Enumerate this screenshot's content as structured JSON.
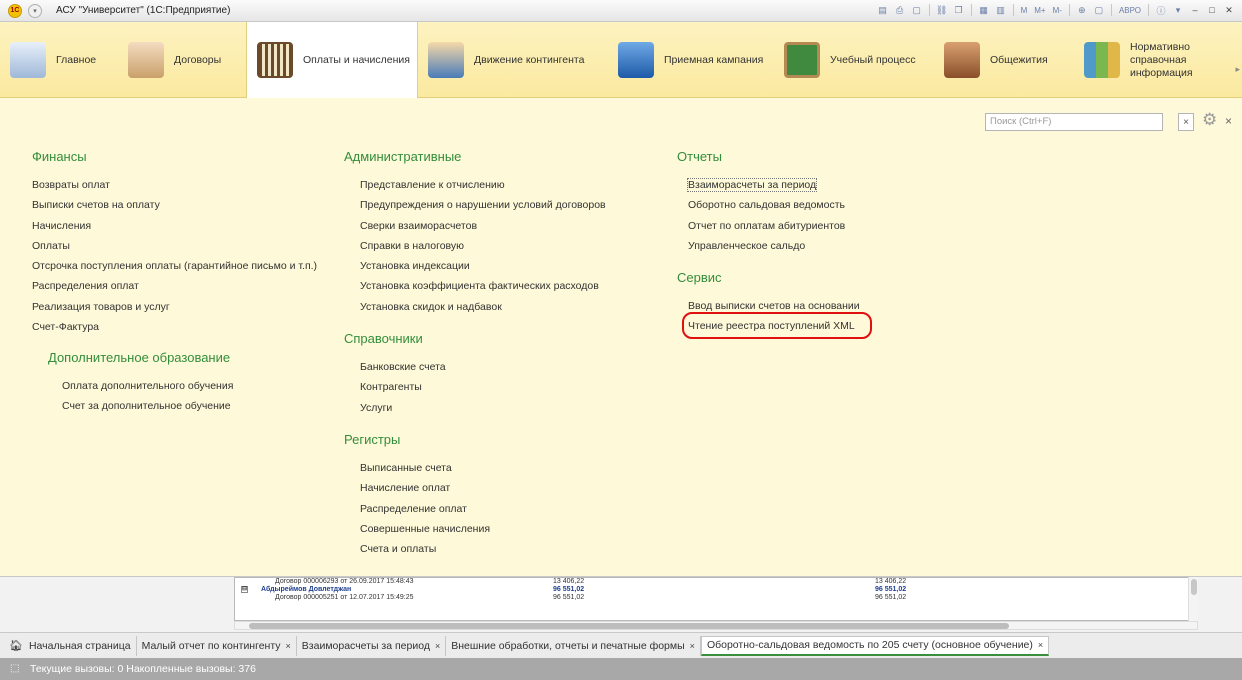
{
  "window": {
    "logo": "1С",
    "title": "АСУ \"Университет\" (1С:Предприятие)",
    "toolbar_text": [
      "M",
      "M+",
      "M-",
      "АВРО"
    ]
  },
  "sections": [
    {
      "label": "Главное",
      "icon": "desk-icon",
      "color": "#7a9cc6"
    },
    {
      "label": "Договоры",
      "icon": "handshake-icon",
      "color": "#c9a06a"
    },
    {
      "label": "Оплаты и начисления",
      "icon": "abacus-icon",
      "color": "#6b4a2a",
      "active": true
    },
    {
      "label": "Движение контингента",
      "icon": "person-desk-icon",
      "color": "#4a7bb8"
    },
    {
      "label": "Приемная кампания",
      "icon": "graduate-icon",
      "color": "#2e6fb8"
    },
    {
      "label": "Учебный процесс",
      "icon": "blackboard-icon",
      "color": "#3f8a3f"
    },
    {
      "label": "Общежития",
      "icon": "house-icon",
      "color": "#a5643a"
    },
    {
      "label": "Нормативно справочная информация",
      "icon": "books-icon",
      "color": "#4f9ac9"
    }
  ],
  "search": {
    "placeholder": "Поиск (Ctrl+F)",
    "clear": "×"
  },
  "close_label": "×",
  "groups": {
    "finance": {
      "title": "Финансы",
      "items": [
        "Возвраты оплат",
        "Выписки счетов на оплату",
        "Начисления",
        "Оплаты",
        "Отсрочка поступления оплаты (гарантийное письмо и т.п.)",
        "Распределения оплат",
        "Реализация товаров и услуг",
        "Счет-Фактура"
      ]
    },
    "extra_edu": {
      "title": "Дополнительное образование",
      "items": [
        "Оплата дополнительного обучения",
        "Счет за дополнительное обучение"
      ]
    },
    "admin": {
      "title": "Административные",
      "items": [
        "Представление к отчислению",
        "Предупреждения о нарушении условий договоров",
        "Сверки взаиморасчетов",
        "Справки в налоговую",
        "Установка индексации",
        "Установка коэффициента фактических расходов",
        "Установка скидок и надбавок"
      ]
    },
    "catalogs": {
      "title": "Справочники",
      "items": [
        "Банковские счета",
        "Контрагенты",
        "Услуги"
      ]
    },
    "registers": {
      "title": "Регистры",
      "items": [
        "Выписанные счета",
        "Начисление оплат",
        "Распределение оплат",
        "Совершенные начисления",
        "Счета и оплаты"
      ]
    },
    "reports": {
      "title": "Отчеты",
      "items": [
        "Взаиморасчеты за период",
        "Оборотно сальдовая ведомость",
        "Отчет по оплатам абитуриентов",
        "Управленческое сальдо"
      ]
    },
    "service": {
      "title": "Сервис",
      "items": [
        "Ввод выписки счетов на основании",
        "Чтение реестра поступлений XML"
      ]
    }
  },
  "background_table": {
    "rows": [
      {
        "label": "Договор 000006293 от 26.09.2017 15:48:43",
        "v1": "13 406,22",
        "v2": "13 406,22",
        "bold": false
      },
      {
        "label": "Абдыреймов Довлетджан",
        "v1": "96 551,02",
        "v2": "96 551,02",
        "bold": true,
        "tree": "⊟"
      },
      {
        "label": "Договор 000005251 от 12.07.2017 15:49:25",
        "v1": "96 551,02",
        "v2": "96 551,02",
        "bold": false
      }
    ]
  },
  "open_tabs": [
    {
      "label": "Начальная страница",
      "home": true
    },
    {
      "label": "Малый отчет по контингенту",
      "close": "×"
    },
    {
      "label": "Взаиморасчеты за период",
      "close": "×"
    },
    {
      "label": "Внешние обработки, отчеты и печатные формы",
      "close": "×"
    },
    {
      "label": "Оборотно-сальдовая ведомость по 205 счету (основное обучение)",
      "close": "×",
      "active": true
    }
  ],
  "status": {
    "text": "Текущие вызовы: 0   Накопленные вызовы: 376"
  }
}
